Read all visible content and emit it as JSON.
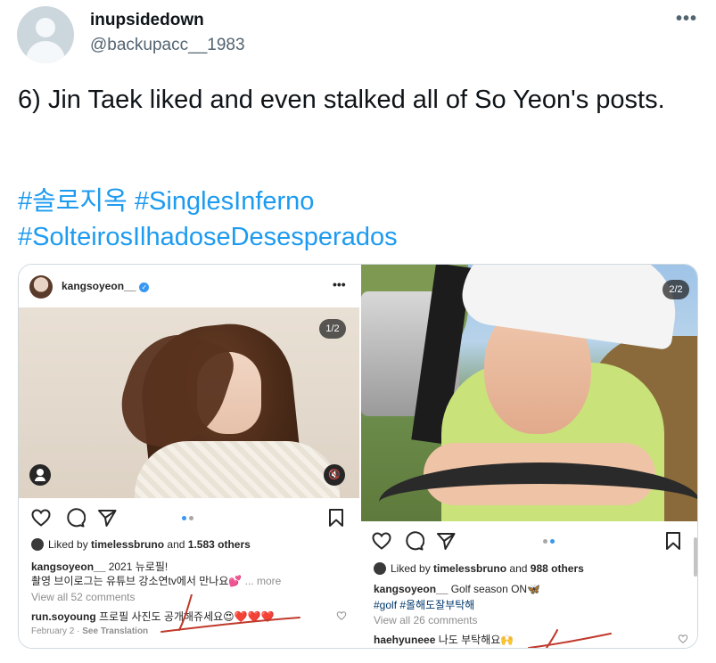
{
  "tweet": {
    "display_name": "inupsidedown",
    "handle": "@backupacc__1983",
    "more_icon": "more-dots-icon",
    "text": "6) Jin Taek liked and even stalked all of So Yeon's posts.",
    "hashtags": [
      "#솔로지옥 #SinglesInferno",
      "#SolteirosIlhadoseDesesperados"
    ],
    "hashtag_color": "#1d9bf0"
  },
  "post_left": {
    "username": "kangsoyeon__",
    "verified_icon": "verified-icon",
    "counter": "1/2",
    "liked_by": "Liked by ",
    "liked_user": "timelessbruno",
    "liked_rest": " and ",
    "liked_count": "1.583 others",
    "caption_user": "kangsoyeon__",
    "caption": " 2021 뉴로필!",
    "caption_line2": "촬영 브이로그는 유튜브 강소연tv에서 만나요💕",
    "more": " ... more",
    "view_all": "View all 52 comments",
    "comment_user": "run.soyoung",
    "comment": " 프로필 사진도 공개해쥬세요😍❤️❤️❤️",
    "date": "February 2",
    "see_translation": "See Translation"
  },
  "post_right": {
    "counter": "2/2",
    "liked_by": "Liked by ",
    "liked_user": "timelessbruno",
    "liked_rest": " and ",
    "liked_count": "988 others",
    "caption_user": "kangsoyeon__",
    "caption": " Golf season ON🦋",
    "tags": "#golf #올해도잘부탁해",
    "view_all": "View all 26 comments",
    "comment_user": "haehyuneee",
    "comment": " 나도 부탁해요🙌"
  },
  "colors": {
    "ig_text": "#262626",
    "ig_muted": "#8e8e8e",
    "ig_blue_dot": "#3897f0",
    "annotation_red": "#c0392b"
  }
}
